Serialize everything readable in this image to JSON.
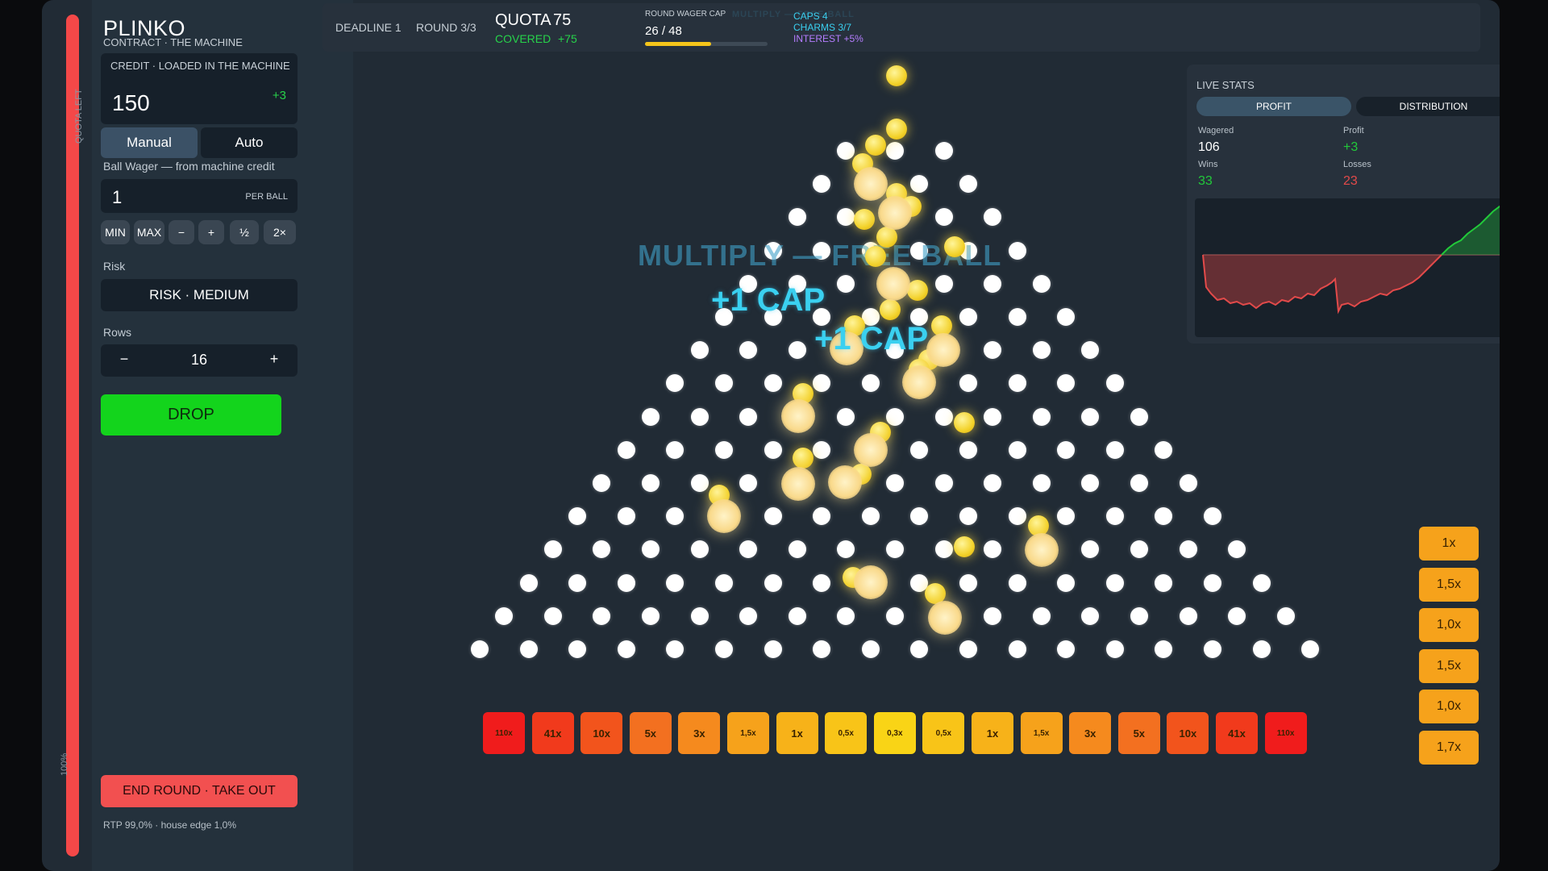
{
  "left_strip": {
    "top_label": "QUOTA LEFT",
    "bottom_label": "100%"
  },
  "sidebar": {
    "title": "PLINKO",
    "subtitle": "CONTRACT · THE MACHINE",
    "credit": {
      "header": "CREDIT · LOADED IN THE MACHINE",
      "value": "150",
      "delta": "+3"
    },
    "mode_tabs": [
      {
        "label": "Manual"
      },
      {
        "label": "Auto"
      }
    ],
    "wager_label": "Ball Wager — from machine credit",
    "wager": {
      "value": "1",
      "unit": "PER BALL"
    },
    "wager_buttons": [
      {
        "label": "MIN"
      },
      {
        "label": "MAX"
      },
      {
        "label": "−"
      },
      {
        "label": "+"
      },
      {
        "label": "½"
      },
      {
        "label": "2×"
      }
    ],
    "risk_label": "Risk",
    "risk_value": "RISK · MEDIUM",
    "rows_label": "Rows",
    "rows": {
      "minus": "−",
      "value": "16",
      "plus": "+"
    },
    "drop_label": "DROP",
    "end_round_label": "END ROUND · TAKE OUT",
    "footer": "RTP 99,0% · house edge 1,0%"
  },
  "topbar": {
    "deadline": "DEADLINE 1",
    "round": "ROUND 3/3",
    "quota_label": "QUOTA",
    "quota_value": "75",
    "covered_label": "COVERED",
    "covered_value": "+75",
    "wager_cap_label": "ROUND WAGER CAP",
    "wager_cap_value": "26 / 48",
    "wager_cap_fraction": 0.54,
    "caps": "CAPS 4",
    "charms": "CHARMS 3/7",
    "interest": "INTEREST +5%",
    "faded_banner": "MULTIPLY — FREE BALL"
  },
  "board": {
    "banner": "MULTIPLY — FREE BALL",
    "cap_popups": [
      "+1 CAP",
      "+1 CAP"
    ],
    "multipliers": [
      "110x",
      "41x",
      "10x",
      "5x",
      "3x",
      "1,5x",
      "1x",
      "0,5x",
      "0,3x",
      "0,5x",
      "1x",
      "1,5x",
      "3x",
      "5x",
      "10x",
      "41x",
      "110x"
    ],
    "multiplier_colors": [
      "#f01c1c",
      "#f13a1c",
      "#f2541c",
      "#f37020",
      "#f58a1e",
      "#f6a21b",
      "#f7b219",
      "#f8c418",
      "#f9d416",
      "#f8c418",
      "#f7b219",
      "#f6a21b",
      "#f58a1e",
      "#f37020",
      "#f2541c",
      "#f13a1c",
      "#f01c1c"
    ]
  },
  "recent_results": [
    "1x",
    "1,5x",
    "1,0x",
    "1,5x",
    "1,0x",
    "1,7x"
  ],
  "live_stats": {
    "title": "LIVE STATS",
    "tabs": [
      {
        "label": "PROFIT"
      },
      {
        "label": "DISTRIBUTION"
      }
    ],
    "wagered_label": "Wagered",
    "wagered_value": "106",
    "profit_label": "Profit",
    "profit_value": "+3",
    "wins_label": "Wins",
    "wins_value": "33",
    "losses_label": "Losses",
    "losses_value": "23",
    "colors": {
      "positive": "#22c93a",
      "negative": "#e24a4a"
    }
  }
}
